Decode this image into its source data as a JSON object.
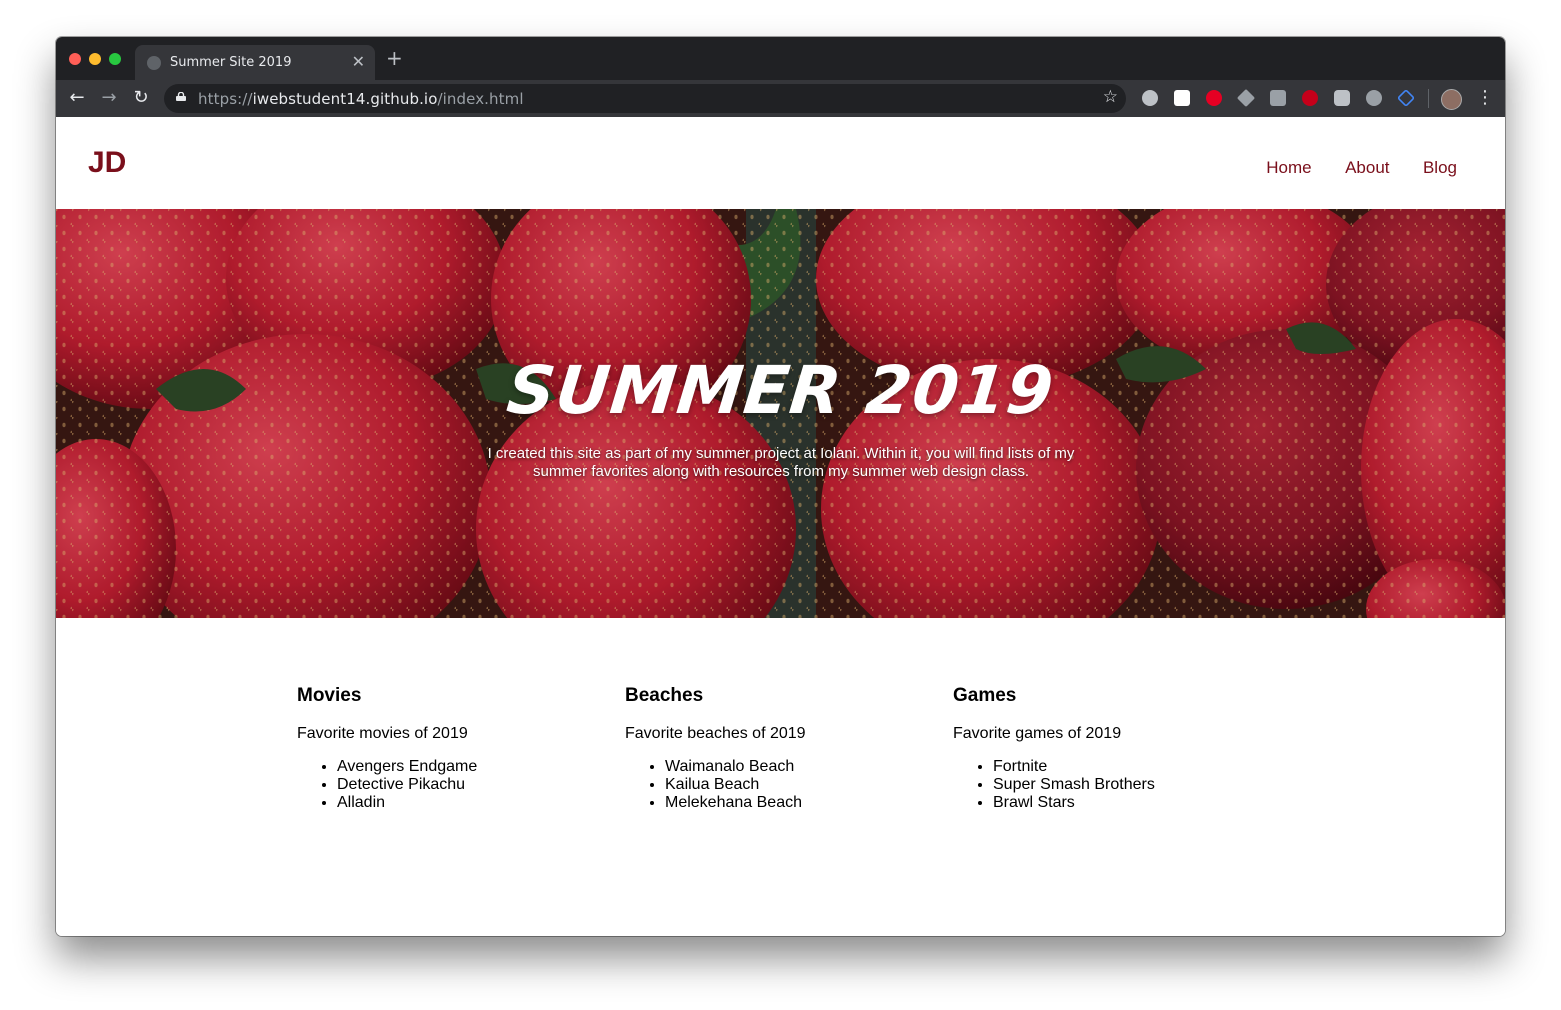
{
  "browser": {
    "tab_title": "Summer Site 2019",
    "url_scheme": "https://",
    "url_host": "iwebstudent14.github.io",
    "url_path": "/index.html"
  },
  "site": {
    "logo": "JD",
    "nav": [
      "Home",
      "About",
      "Blog"
    ]
  },
  "hero": {
    "title": "SUMMER 2019",
    "text": "I created this site as part of my summer project at Iolani. Within it, you will find lists of my summer favorites along with resources from my summer web design class."
  },
  "columns": [
    {
      "heading": "Movies",
      "subtitle": "Favorite movies of 2019",
      "items": [
        "Avengers Endgame",
        "Detective Pikachu",
        "Alladin"
      ]
    },
    {
      "heading": "Beaches",
      "subtitle": "Favorite beaches of 2019",
      "items": [
        "Waimanalo Beach",
        "Kailua Beach",
        "Melekehana Beach"
      ]
    },
    {
      "heading": "Games",
      "subtitle": "Favorite games of 2019",
      "items": [
        "Fortnite",
        "Super Smash Brothers",
        "Brawl Stars"
      ]
    }
  ],
  "colors": {
    "accent": "#7a0f1b",
    "chrome_dark": "#202124",
    "chrome_toolbar": "#35363a"
  }
}
